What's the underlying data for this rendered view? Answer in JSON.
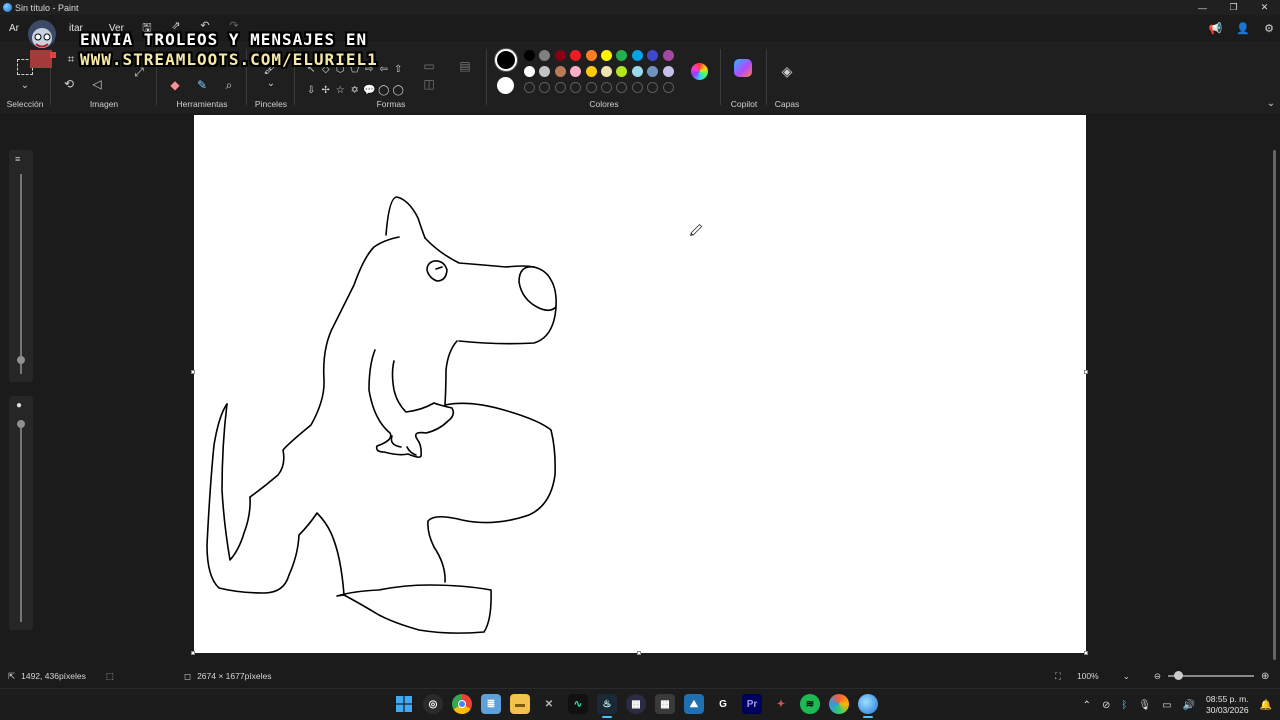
{
  "window": {
    "title": "Sin título - Paint",
    "controls": [
      "—",
      "❐",
      "✕"
    ]
  },
  "menu": {
    "items": [
      "Ar",
      "itar",
      "Ver"
    ]
  },
  "overlay": {
    "line1": "ENVIA TROLEOS Y MENSAJES EN",
    "line2": "WWW.STREAMLOOTS.COM/ELURIEL1"
  },
  "ribbon": {
    "groups": {
      "seleccion": "Selección",
      "imagen": "Imagen",
      "herramientas": "Herramientas",
      "pinceles": "Pinceles",
      "formas": "Formas",
      "colores": "Colores",
      "copilot": "Copilot",
      "capas": "Capas"
    },
    "shapes": [
      "↖",
      "◇",
      "⬡",
      "⬠",
      "⇨",
      "⇦",
      "⇧",
      "⇩",
      "✢",
      "☆",
      "✡",
      "💬",
      "◯",
      "◯"
    ],
    "colors_row1": [
      "#000000",
      "#7f7f7f",
      "#880015",
      "#ed1c24",
      "#ff7f27",
      "#fff200",
      "#22b14c",
      "#00a2e8",
      "#3f48cc",
      "#a349a4"
    ],
    "colors_row2": [
      "#ffffff",
      "#c3c3c3",
      "#b97a57",
      "#ffaec9",
      "#ffc90e",
      "#efe4b0",
      "#b5e61d",
      "#99d9ea",
      "#7092be",
      "#c8bfe7"
    ]
  },
  "status": {
    "cursor_pos": "1492, 436píxeles",
    "canvas_size": "2674 × 1677píxeles",
    "zoom": "100%"
  },
  "taskbar": {
    "time": "08:55 p. m.",
    "date": "30/03/2026"
  }
}
